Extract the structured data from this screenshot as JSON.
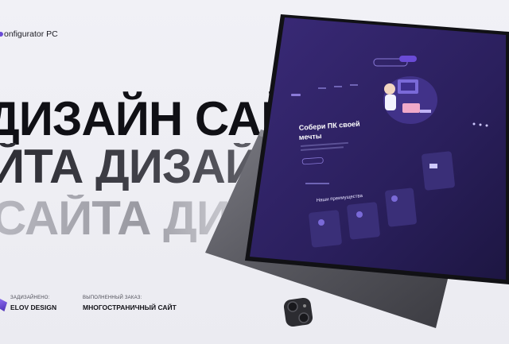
{
  "brand": {
    "name": "onfigurator PC"
  },
  "headline": {
    "line1": "ДИЗАЙН САЙТ",
    "line2": "ЙТА ДИЗАЙН",
    "line3": "САЙТА ДИЗ"
  },
  "footer": {
    "designed_label": "ЗАДИЗАЙНЕНО:",
    "designer": "ELOV DESIGN",
    "order_label": "ВЫПОЛНЕННЫЙ ЗАКАЗ:",
    "order": "МНОГОСТРАНИЧНЫЙ САЙТ"
  },
  "screen": {
    "hero_title_1": "Собери ПК своей",
    "hero_title_2": "мечты",
    "section_title": "Наши преимущества"
  },
  "colors": {
    "accent": "#6a4bd6",
    "screen_bg": "#2a1f5c",
    "device": "#55555c"
  }
}
